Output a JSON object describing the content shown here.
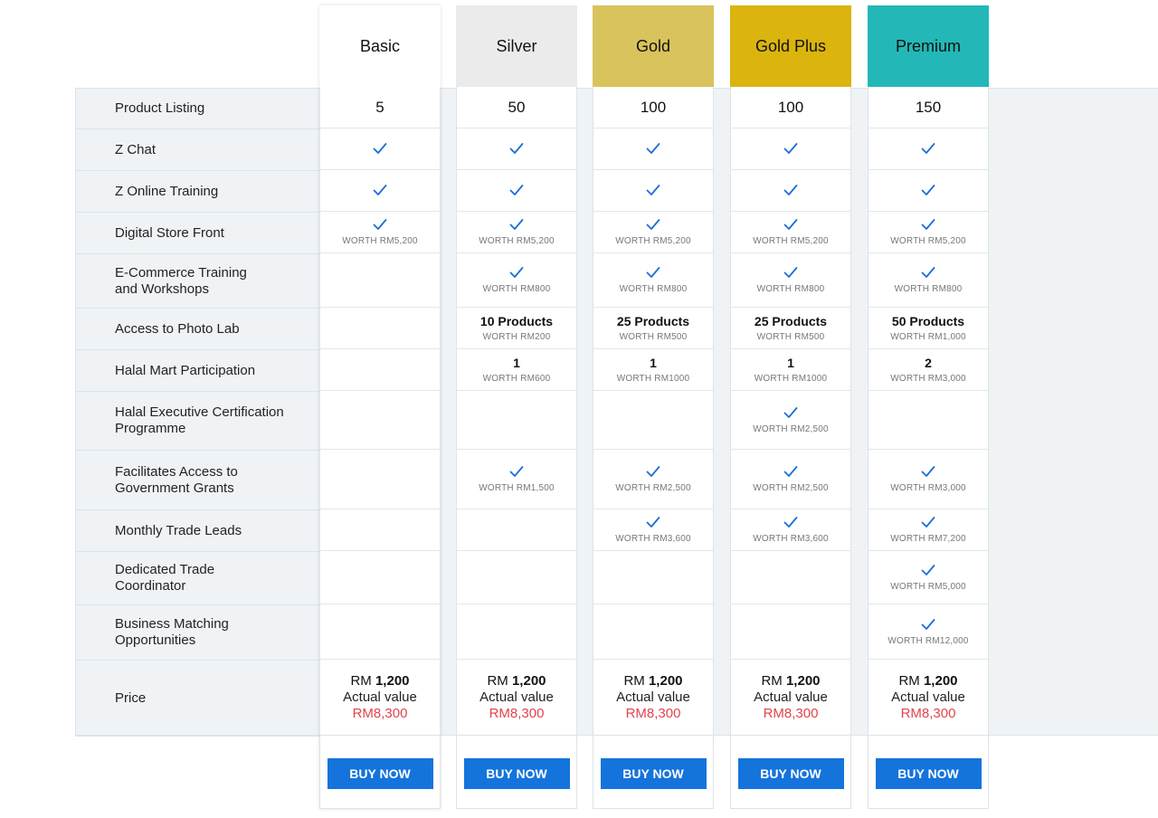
{
  "features": [
    "Product Listing",
    "Z Chat",
    "Z Online Training",
    "Digital Store Front",
    "E-Commerce Training\nand Workshops",
    "Access to Photo Lab",
    "Halal Mart Participation",
    "Halal Executive Certification\nProgramme",
    "Facilitates Access to\nGovernment Grants",
    "Monthly Trade Leads",
    "Dedicated Trade\nCoordinator",
    "Business Matching\nOpportunities",
    "Price"
  ],
  "buy_label": "BUY NOW",
  "colors": {
    "basic": "#ffffff",
    "silver": "#ebebeb",
    "gold": "#d9c35c",
    "gold_plus": "#dbb40d",
    "premium": "#23b8b7",
    "check": "#1a6fd6",
    "button": "#1474dc",
    "actual_value": "#e2434b"
  },
  "plans": [
    {
      "id": "basic",
      "name": "Basic",
      "cells": [
        {
          "type": "number",
          "value": "5"
        },
        {
          "type": "check"
        },
        {
          "type": "check"
        },
        {
          "type": "check",
          "worth": "WORTH RM5,200"
        },
        {
          "type": "empty"
        },
        {
          "type": "empty"
        },
        {
          "type": "empty"
        },
        {
          "type": "empty"
        },
        {
          "type": "empty"
        },
        {
          "type": "empty"
        },
        {
          "type": "empty"
        },
        {
          "type": "empty"
        }
      ],
      "price": {
        "prefix": "RM ",
        "amount": "1,200",
        "actual_label": "Actual value",
        "actual": "RM8,300"
      }
    },
    {
      "id": "silver",
      "name": "Silver",
      "cells": [
        {
          "type": "number",
          "value": "50"
        },
        {
          "type": "check"
        },
        {
          "type": "check"
        },
        {
          "type": "check",
          "worth": "WORTH RM5,200"
        },
        {
          "type": "check",
          "worth": "WORTH RM800"
        },
        {
          "type": "text",
          "value": "10 Products",
          "worth": "WORTH RM200"
        },
        {
          "type": "text",
          "value": "1",
          "worth": "WORTH RM600"
        },
        {
          "type": "empty"
        },
        {
          "type": "check",
          "worth": "WORTH RM1,500"
        },
        {
          "type": "empty"
        },
        {
          "type": "empty"
        },
        {
          "type": "empty"
        }
      ],
      "price": {
        "prefix": "RM ",
        "amount": "1,200",
        "actual_label": "Actual value",
        "actual": "RM8,300"
      }
    },
    {
      "id": "gold",
      "name": "Gold",
      "cells": [
        {
          "type": "number",
          "value": "100"
        },
        {
          "type": "check"
        },
        {
          "type": "check"
        },
        {
          "type": "check",
          "worth": "WORTH RM5,200"
        },
        {
          "type": "check",
          "worth": "WORTH RM800"
        },
        {
          "type": "text",
          "value": "25 Products",
          "worth": "WORTH RM500"
        },
        {
          "type": "text",
          "value": "1",
          "worth": "WORTH RM1000"
        },
        {
          "type": "empty"
        },
        {
          "type": "check",
          "worth": "WORTH RM2,500"
        },
        {
          "type": "check",
          "worth": "WORTH RM3,600"
        },
        {
          "type": "empty"
        },
        {
          "type": "empty"
        }
      ],
      "price": {
        "prefix": "RM ",
        "amount": "1,200",
        "actual_label": "Actual value",
        "actual": "RM8,300"
      }
    },
    {
      "id": "gold_plus",
      "name": "Gold Plus",
      "cells": [
        {
          "type": "number",
          "value": "100"
        },
        {
          "type": "check"
        },
        {
          "type": "check"
        },
        {
          "type": "check",
          "worth": "WORTH RM5,200"
        },
        {
          "type": "check",
          "worth": "WORTH RM800"
        },
        {
          "type": "text",
          "value": "25 Products",
          "worth": "WORTH RM500"
        },
        {
          "type": "text",
          "value": "1",
          "worth": "WORTH RM1000"
        },
        {
          "type": "check",
          "worth": "WORTH RM2,500"
        },
        {
          "type": "check",
          "worth": "WORTH RM2,500"
        },
        {
          "type": "check",
          "worth": "WORTH RM3,600"
        },
        {
          "type": "empty"
        },
        {
          "type": "empty"
        }
      ],
      "price": {
        "prefix": "RM ",
        "amount": "1,200",
        "actual_label": "Actual value",
        "actual": "RM8,300"
      }
    },
    {
      "id": "premium",
      "name": "Premium",
      "cells": [
        {
          "type": "number",
          "value": "150"
        },
        {
          "type": "check"
        },
        {
          "type": "check"
        },
        {
          "type": "check",
          "worth": "WORTH RM5,200"
        },
        {
          "type": "check",
          "worth": "WORTH RM800"
        },
        {
          "type": "text",
          "value": "50 Products",
          "worth": "WORTH RM1,000"
        },
        {
          "type": "text",
          "value": "2",
          "worth": "WORTH RM3,000"
        },
        {
          "type": "empty"
        },
        {
          "type": "check",
          "worth": "WORTH RM3,000"
        },
        {
          "type": "check",
          "worth": "WORTH RM7,200"
        },
        {
          "type": "check",
          "worth": "WORTH RM5,000"
        },
        {
          "type": "check",
          "worth": "WORTH RM12,000"
        }
      ],
      "price": {
        "prefix": "RM ",
        "amount": "1,200",
        "actual_label": "Actual value",
        "actual": "RM8,300"
      }
    }
  ]
}
